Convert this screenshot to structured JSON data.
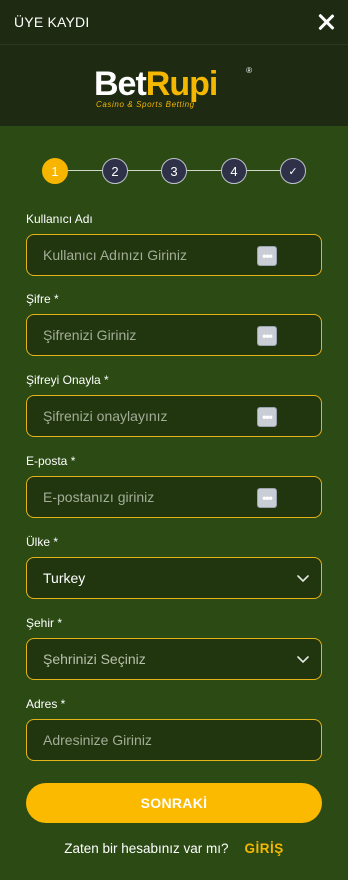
{
  "header": {
    "title": "ÜYE KAYDI",
    "close_icon": "close-icon"
  },
  "brand": {
    "bet": "Bet",
    "rupi": "Rupi",
    "tagline": "Casino & Sports Betting",
    "reg": "®"
  },
  "steps": [
    "1",
    "2",
    "3",
    "4",
    "✓"
  ],
  "active_step": 1,
  "form": {
    "username": {
      "label": "Kullanıcı Adı",
      "placeholder": "Kullanıcı Adınızı Giriniz"
    },
    "password": {
      "label": "Şifre *",
      "placeholder": "Şifrenizi Giriniz"
    },
    "password_confirm": {
      "label": "Şifreyi Onayla *",
      "placeholder": "Şifrenizi onaylayınız"
    },
    "email": {
      "label": "E-posta *",
      "placeholder": "E-postanızı giriniz"
    },
    "country": {
      "label": "Ülke *",
      "value": "Turkey"
    },
    "city": {
      "label": "Şehir *",
      "placeholder": "Şehrinizi Seçiniz"
    },
    "address": {
      "label": "Adres *",
      "placeholder": "Adresinize Giriniz"
    }
  },
  "actions": {
    "next_label": "SONRAKİ",
    "have_account": "Zaten bir hesabınız var mı?",
    "login_label": "GİRİŞ"
  },
  "colors": {
    "accent": "#fbb900",
    "background": "#2b4a14",
    "header": "#1e2a12"
  }
}
